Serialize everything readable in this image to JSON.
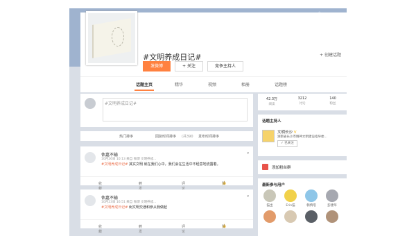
{
  "header": {
    "title": "#文明养成日记#",
    "create_topic": "+ 创建话题",
    "buttons": {
      "post": "发微博",
      "follow": "+ 关注",
      "host": "竞争主持人"
    }
  },
  "tabs": [
    "话题主页",
    "精华",
    "视频",
    "相册",
    "话题榜"
  ],
  "composer": {
    "placeholder": "#文明养成日记#"
  },
  "sortbar": {
    "hot": "热门排序",
    "time": "回复时间排序",
    "count": "(共390",
    "publish": "发布时间排序"
  },
  "posts": [
    {
      "name": "佑嘉不输",
      "meta": "10月26日 10:13 来自 微博 文明养成...",
      "tag": "#文明养成日记#",
      "text": " 其实文明 就在我们心中，我们会在生活中不经意地流露着。",
      "actions": {
        "fav": "收藏",
        "repost": "转发",
        "comment": "评论",
        "like": "赞"
      }
    },
    {
      "name": "佑嘉不输",
      "meta": "10月23日 16:51 来自 微博 文明养成...",
      "tag": "#文明养成日记#",
      "text": " 树文明交通和参从我做起",
      "actions": {
        "fav": "收藏",
        "repost": "转发",
        "comment": "评论",
        "like": "赞"
      }
    }
  ],
  "stats": [
    {
      "value": "42.3万",
      "label": "阅读"
    },
    {
      "value": "3212",
      "label": "讨论"
    },
    {
      "value": "140",
      "label": "粉丝"
    }
  ],
  "host": {
    "section_title": "话题主持人",
    "name": "文明长沙",
    "verified": "V",
    "desc": "湖南省长沙市精神文明建设指导委...",
    "follow_label": "✓ 已关注"
  },
  "join_group": {
    "label": "添加粉丝群"
  },
  "recent_users": {
    "title": "最新参与用户",
    "users": [
      {
        "name": "猫出",
        "color": "#c9c7b8"
      },
      {
        "name": "Erin猫",
        "color": "#f1d14a"
      },
      {
        "name": "鹌鹑嗒",
        "color": "#8ec6e8"
      },
      {
        "name": "彭建华",
        "color": "#a6a8b0"
      },
      {
        "name": "",
        "color": "#e29b6a"
      },
      {
        "name": "",
        "color": "#d8c9b2"
      },
      {
        "name": "",
        "color": "#5a5f66"
      },
      {
        "name": "",
        "color": "#b09279"
      }
    ]
  },
  "colors": {
    "accent": "#ff8140",
    "tag": "#eb7350",
    "banner": "#9fb3cf",
    "background": "#d9dee6"
  }
}
